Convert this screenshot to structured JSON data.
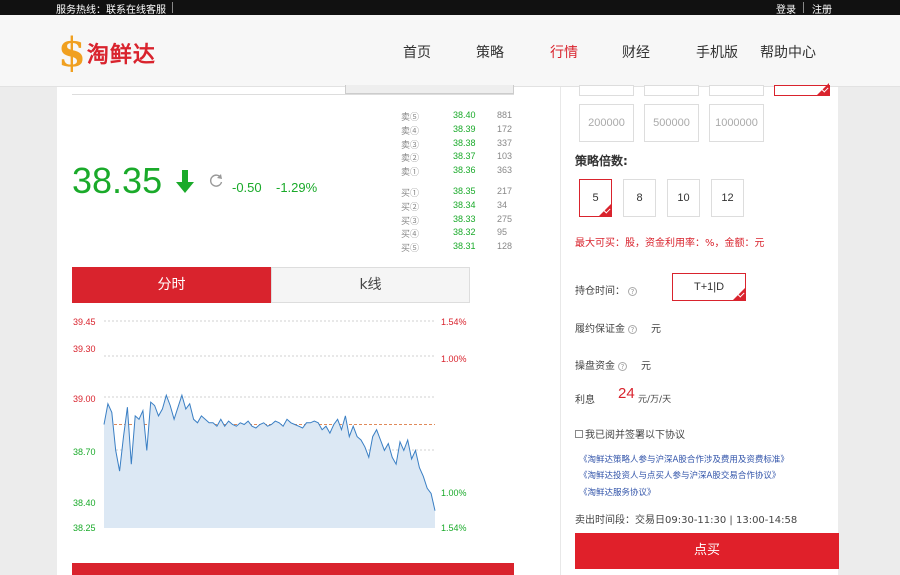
{
  "topbar": {
    "hotline": "服务热线：联系在线客服",
    "login": "登录",
    "register": "注册"
  },
  "logo": {
    "symbol": "$",
    "text": "淘鲜达"
  },
  "nav": {
    "items": [
      "首页",
      "策略",
      "行情",
      "财经",
      "手机版",
      "帮助中心"
    ],
    "active": "行情"
  },
  "quote": {
    "price": "38.35",
    "change": "-0.50",
    "change_pct": "-1.29%",
    "direction": "down",
    "order_book": {
      "asks": [
        {
          "label": "卖⑤",
          "price": "38.40",
          "volume": "881"
        },
        {
          "label": "卖④",
          "price": "38.39",
          "volume": "172"
        },
        {
          "label": "卖③",
          "price": "38.38",
          "volume": "337"
        },
        {
          "label": "卖②",
          "price": "38.37",
          "volume": "103"
        },
        {
          "label": "卖①",
          "price": "38.36",
          "volume": "363"
        }
      ],
      "bids": [
        {
          "label": "买①",
          "price": "38.35",
          "volume": "217"
        },
        {
          "label": "买②",
          "price": "38.34",
          "volume": "34"
        },
        {
          "label": "买③",
          "price": "38.33",
          "volume": "275"
        },
        {
          "label": "买④",
          "price": "38.32",
          "volume": "95"
        },
        {
          "label": "买⑤",
          "price": "38.31",
          "volume": "128"
        }
      ]
    }
  },
  "chart_tabs": {
    "minute": "分时",
    "kline": "k线",
    "active": "分时"
  },
  "chart_data": {
    "type": "area",
    "yticks_left": [
      "39.45",
      "39.30",
      "39.00",
      "38.70",
      "38.40",
      "38.25"
    ],
    "yticks_right": [
      "1.54%",
      "1.00%",
      "1.00%",
      "1.54%"
    ],
    "reference_price": 38.85,
    "ylim": [
      38.25,
      39.45
    ],
    "values": [
      38.85,
      38.97,
      38.92,
      38.7,
      38.58,
      38.78,
      38.95,
      38.62,
      38.9,
      38.88,
      38.93,
      38.7,
      38.98,
      38.96,
      38.9,
      38.94,
      39.02,
      38.96,
      38.88,
      38.95,
      39.02,
      38.94,
      38.97,
      38.88,
      38.86,
      38.9,
      38.88,
      38.86,
      38.86,
      38.84,
      38.88,
      38.84,
      38.87,
      38.85,
      38.84,
      38.86,
      38.85,
      38.87,
      38.84,
      38.83,
      38.85,
      38.86,
      38.84,
      38.85,
      38.87,
      38.86,
      38.84,
      38.88,
      38.86,
      38.85,
      38.84,
      38.83,
      38.86,
      38.86,
      38.87,
      38.86,
      38.82,
      38.84,
      38.8,
      38.85,
      38.88,
      38.82,
      38.9,
      38.78,
      38.84,
      38.78,
      38.76,
      38.72,
      38.66,
      38.78,
      38.82,
      38.76,
      38.7,
      38.74,
      38.66,
      38.62,
      38.75,
      38.7,
      38.76,
      38.65,
      38.7,
      38.6,
      38.55,
      38.48,
      38.45,
      38.35
    ],
    "colors": {
      "line": "#3a7fc4",
      "fill": "#dce8f4",
      "up": "#d9232d",
      "down": "#1aaa2a"
    }
  },
  "sidebar": {
    "amounts": [
      "200000",
      "500000",
      "1000000"
    ],
    "multiplier_title": "策略倍数:",
    "multipliers": [
      "5",
      "8",
      "10",
      "12"
    ],
    "selected_multiplier": "5",
    "max_buy_note": "最大可买：股，资金利用率：%，金额：元",
    "hold_label": "持仓时间：",
    "hold_value": "T+1|D",
    "deposit_label": "履约保证金",
    "deposit_unit": "元",
    "capital_label": "操盘资金",
    "capital_unit": "元",
    "interest_label": "利息",
    "interest_value": "24",
    "interest_unit": "元/万/天",
    "agree_text": "我已阅并签署以下协议",
    "links": [
      "《淘鲜达策略人参与沪深A股合作涉及费用及资费标准》",
      "《淘鲜达投资人与点买人参与沪深A股交易合作协议》",
      "《淘鲜达服务协议》"
    ],
    "trade_time": "卖出时间段：交易日09:30-11:30 | 13:00-14:58",
    "buy_button": "点买"
  }
}
